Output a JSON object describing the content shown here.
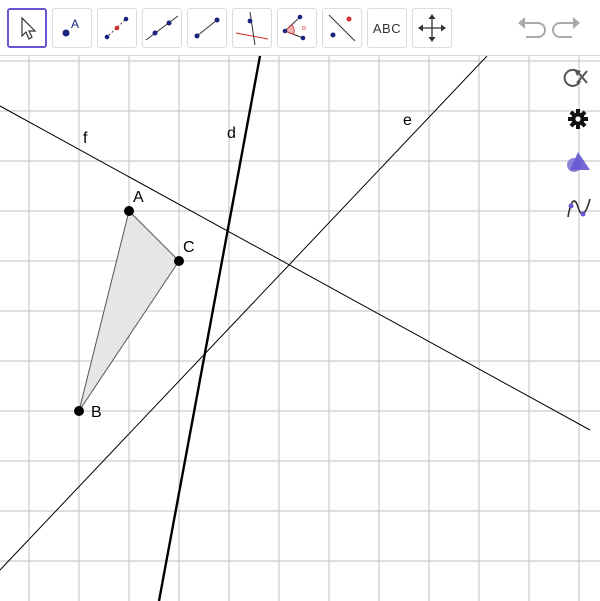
{
  "toolbar": {
    "tools": [
      {
        "id": "move",
        "icon": "move-arrow-icon",
        "selected": true
      },
      {
        "id": "point",
        "icon": "point-icon",
        "label": "A"
      },
      {
        "id": "segment",
        "icon": "segment-icon"
      },
      {
        "id": "line",
        "icon": "line-icon"
      },
      {
        "id": "ray",
        "icon": "ray-icon"
      },
      {
        "id": "perpendicular",
        "icon": "perpendicular-line-icon"
      },
      {
        "id": "angle",
        "icon": "angle-icon"
      },
      {
        "id": "reflect",
        "icon": "reflect-icon"
      },
      {
        "id": "text",
        "icon": "text-icon",
        "label": "ABC"
      },
      {
        "id": "move-graphics",
        "icon": "move-graphics-icon"
      }
    ],
    "undo_icon": "undo-icon",
    "redo_icon": "redo-icon"
  },
  "side_icons": [
    "reset-construction-icon",
    "settings-gear-icon",
    "shapes-icon",
    "function-graph-icon"
  ],
  "graphics": {
    "points": [
      {
        "name": "A",
        "label": "A"
      },
      {
        "name": "B",
        "label": "B"
      },
      {
        "name": "C",
        "label": "C"
      }
    ],
    "lines": [
      {
        "name": "d",
        "label": "d"
      },
      {
        "name": "e",
        "label": "e"
      },
      {
        "name": "f",
        "label": "f"
      }
    ],
    "polygon": {
      "vertices": [
        "A",
        "C",
        "B"
      ],
      "fill": "#e6e6e6"
    },
    "colors": {
      "grid": "#c0c0c0",
      "axis_line": "#000000",
      "point": "#000000",
      "accent": "#6557d2",
      "point_blue": "#1a237e",
      "point_red": "#d32f2f"
    }
  }
}
